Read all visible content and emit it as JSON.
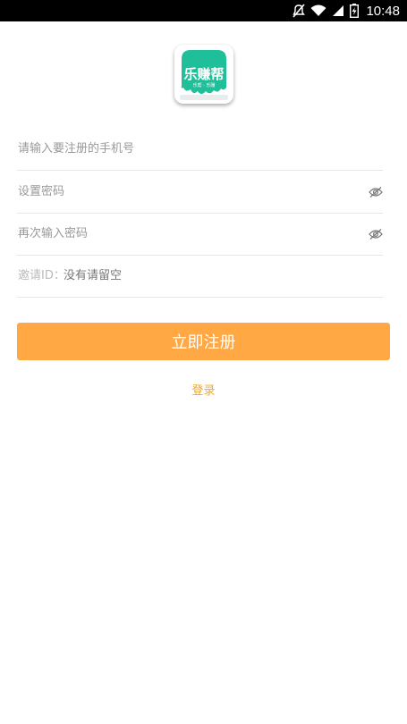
{
  "status_bar": {
    "time": "10:48",
    "icons": [
      "mute-icon",
      "wifi-icon",
      "signal-icon",
      "battery-charging-icon"
    ]
  },
  "logo": {
    "title": "乐赚帮",
    "subtitle": "乐帮 · 乐赚",
    "brand_color": "#1fbf9a"
  },
  "form": {
    "phone_placeholder": "请输入要注册的手机号",
    "password_placeholder": "设置密码",
    "confirm_placeholder": "再次输入密码",
    "invite_prefix": "邀请ID：",
    "invite_placeholder": "没有请留空"
  },
  "register_button": {
    "label": "立即注册",
    "color": "#ffa844"
  },
  "login_link": {
    "label": "登录",
    "color": "#f5a623"
  }
}
